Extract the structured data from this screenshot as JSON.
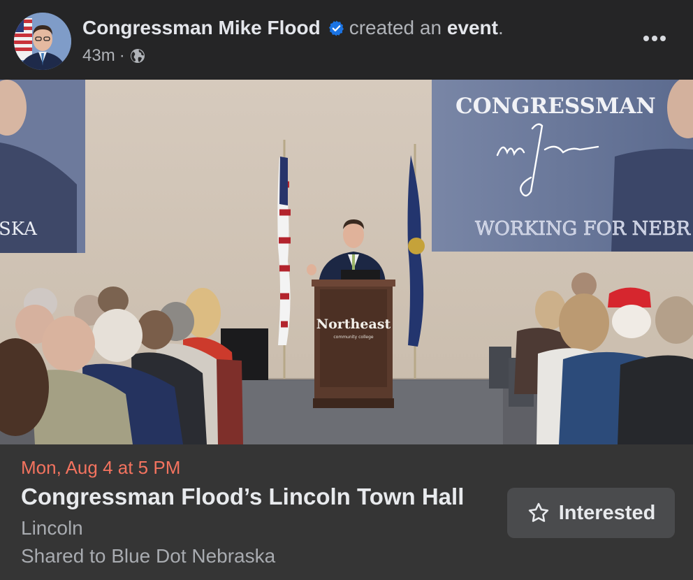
{
  "header": {
    "author": "Congressman Mike Flood",
    "action_prefix": "created an",
    "action_object": "event",
    "action_suffix": ".",
    "timestamp": "43m",
    "separator": "·",
    "audience_icon": "globe-icon",
    "verified_icon": "verified-badge-icon",
    "more_icon": "more-options-icon"
  },
  "photo": {
    "left_screen_text": "SKA",
    "right_screen_title": "CONGRESSMAN",
    "right_screen_signature": "Mike Flood",
    "right_screen_banner": "WORKING FOR NEBR",
    "podium_logo": "Northeast",
    "podium_logo_sub": "community college"
  },
  "event": {
    "date": "Mon, Aug 4 at 5 PM",
    "title": "Congressman Flood’s Lincoln Town Hall",
    "location": "Lincoln",
    "shared_to": "Shared to Blue Dot Nebraska",
    "interested_label": "Interested",
    "interested_icon": "star-outline-icon"
  },
  "colors": {
    "background": "#252526",
    "event_panel": "#353535",
    "date_accent": "#f3735f",
    "verified_blue": "#1b74e4",
    "button_bg": "#4a4b4d"
  }
}
